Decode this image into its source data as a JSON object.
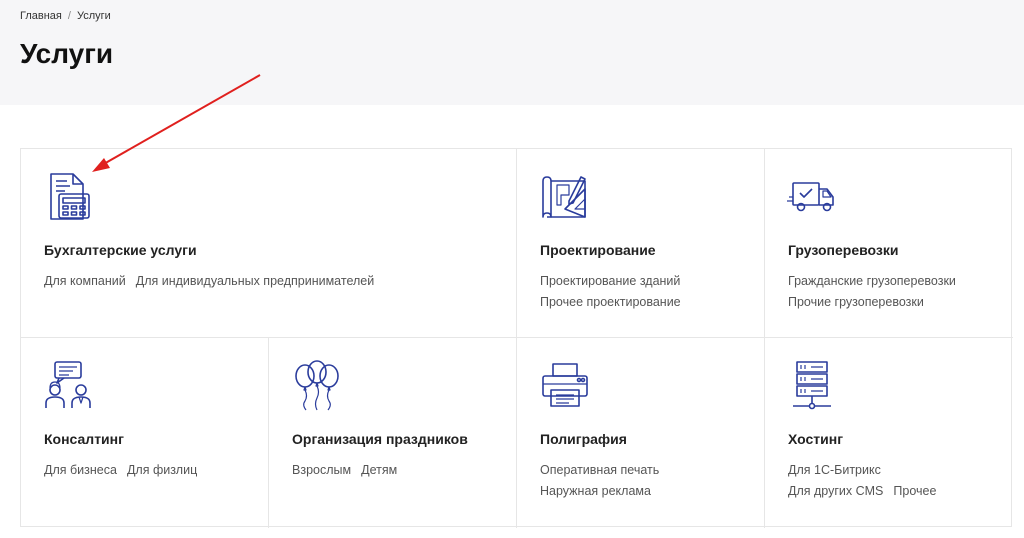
{
  "breadcrumb": {
    "home": "Главная",
    "separator": "/",
    "current": "Услуги"
  },
  "page": {
    "title": "Услуги"
  },
  "services": [
    {
      "icon": "calculator-document-icon",
      "title": "Бухгалтерские услуги",
      "rows": [
        [
          "Для компаний",
          "Для индивидуальных предпринимателей"
        ]
      ]
    },
    {
      "icon": "blueprint-icon",
      "title": "Проектирование",
      "rows": [
        [
          "Проектирование зданий"
        ],
        [
          "Прочее проектирование"
        ]
      ]
    },
    {
      "icon": "truck-icon",
      "title": "Грузоперевозки",
      "rows": [
        [
          "Гражданские грузоперевозки"
        ],
        [
          "Прочие грузоперевозки"
        ]
      ]
    },
    {
      "icon": "consulting-people-icon",
      "title": "Консалтинг",
      "rows": [
        [
          "Для бизнеса",
          "Для физлиц"
        ]
      ]
    },
    {
      "icon": "balloons-icon",
      "title": "Организация праздников",
      "rows": [
        [
          "Взрослым",
          "Детям"
        ]
      ]
    },
    {
      "icon": "printer-icon",
      "title": "Полиграфия",
      "rows": [
        [
          "Оперативная печать"
        ],
        [
          "Наружная реклама"
        ]
      ]
    },
    {
      "icon": "server-icon",
      "title": "Хостинг",
      "rows": [
        [
          "Для 1С-Битрикс"
        ],
        [
          "Для других CMS",
          "Прочее"
        ]
      ]
    }
  ],
  "colors": {
    "accent": "#2a3c9c",
    "arrow": "#e0201e",
    "hero_bg": "#f6f6f8",
    "border": "#e6e6e6"
  }
}
